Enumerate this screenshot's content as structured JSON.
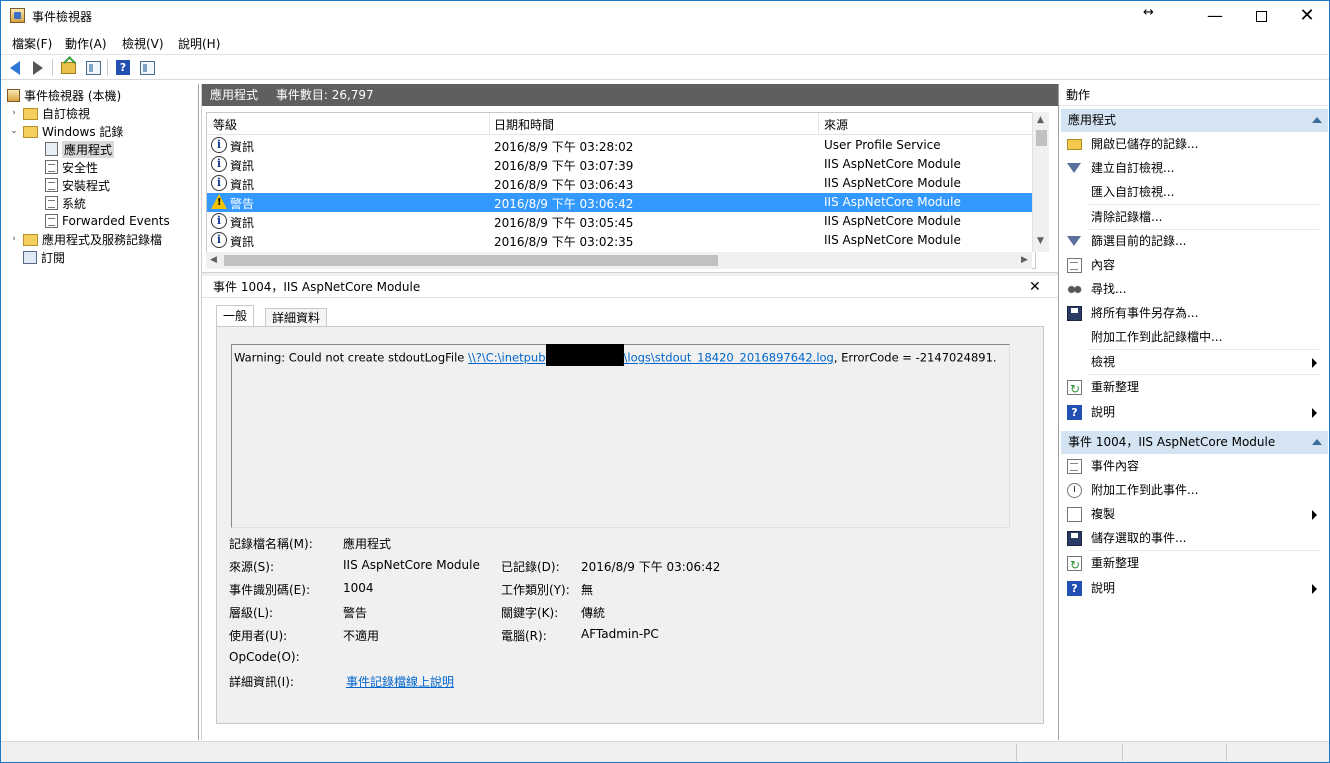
{
  "window": {
    "title": "事件檢視器",
    "resize_glyph": "↔",
    "min": "—",
    "close": "✕"
  },
  "menu": [
    "檔案(F)",
    "動作(A)",
    "檢視(V)",
    "說明(H)"
  ],
  "toolbar": {
    "help": "?"
  },
  "tree": {
    "root": "事件檢視器 (本機)",
    "custom_views": "自訂檢視",
    "windows_logs": "Windows 記錄",
    "logs": [
      "應用程式",
      "安全性",
      "安裝程式",
      "系統",
      "Forwarded Events"
    ],
    "app_services": "應用程式及服務記錄檔",
    "subscriptions": "訂閱",
    "expand_glyph": "›",
    "collapse_glyph": "⌄"
  },
  "center": {
    "log_name": "應用程式",
    "event_count": "事件數目: 26,797",
    "columns": [
      "等級",
      "日期和時間",
      "來源"
    ],
    "rows": [
      {
        "level": "資訊",
        "type": "info",
        "datetime": "2016/8/9 下午 03:28:02",
        "source": "User Profile Service"
      },
      {
        "level": "資訊",
        "type": "info",
        "datetime": "2016/8/9 下午 03:07:39",
        "source": "IIS AspNetCore Module"
      },
      {
        "level": "資訊",
        "type": "info",
        "datetime": "2016/8/9 下午 03:06:43",
        "source": "IIS AspNetCore Module"
      },
      {
        "level": "警告",
        "type": "warning",
        "datetime": "2016/8/9 下午 03:06:42",
        "source": "IIS AspNetCore Module"
      },
      {
        "level": "資訊",
        "type": "info",
        "datetime": "2016/8/9 下午 03:05:45",
        "source": "IIS AspNetCore Module"
      },
      {
        "level": "資訊",
        "type": "info",
        "datetime": "2016/8/9 下午 03:02:35",
        "source": "IIS AspNetCore Module"
      }
    ],
    "selected_row": 3,
    "info_glyph": "i",
    "scroll_up": "▲",
    "scroll_down": "▼",
    "scroll_left": "◀",
    "scroll_right": "▶"
  },
  "detail": {
    "title": "事件 1004，IIS AspNetCore Module",
    "close": "✕",
    "tabs": [
      "一般",
      "詳細資料"
    ],
    "message_prefix": "Warning: Could not create stdoutLogFile ",
    "message_link_start": "\\\\?\\C:\\inetpub",
    "message_link_end": "\\logs\\stdout_18420_2016897642.log",
    "message_suffix": ", ErrorCode = -2147024891.",
    "fields": {
      "log_name_label": "記錄檔名稱(M):",
      "log_name": "應用程式",
      "source_label": "來源(S):",
      "source": "IIS AspNetCore Module",
      "logged_label": "已記錄(D):",
      "logged": "2016/8/9 下午 03:06:42",
      "event_id_label": "事件識別碼(E):",
      "event_id": "1004",
      "task_label": "工作類別(Y):",
      "task": "無",
      "level_label": "層級(L):",
      "level": "警告",
      "keywords_label": "關鍵字(K):",
      "keywords": "傳統",
      "user_label": "使用者(U):",
      "user": "不適用",
      "computer_label": "電腦(R):",
      "computer": "AFTadmin-PC",
      "opcode_label": "OpCode(O):",
      "more_info_label": "詳細資訊(I):",
      "more_info_link": "事件記錄檔線上說明"
    }
  },
  "actions": {
    "title": "動作",
    "section1": "應用程式",
    "items1": [
      "開啟已儲存的記錄...",
      "建立自訂檢視...",
      "匯入自訂檢視...",
      "清除記錄檔...",
      "篩選目前的記錄...",
      "內容",
      "尋找...",
      "將所有事件另存為...",
      "附加工作到此記錄檔中...",
      "檢視",
      "重新整理",
      "說明"
    ],
    "section2": "事件 1004，IIS AspNetCore Module",
    "items2": [
      "事件內容",
      "附加工作到此事件...",
      "複製",
      "儲存選取的事件...",
      "重新整理",
      "說明"
    ],
    "help_glyph": "?"
  }
}
